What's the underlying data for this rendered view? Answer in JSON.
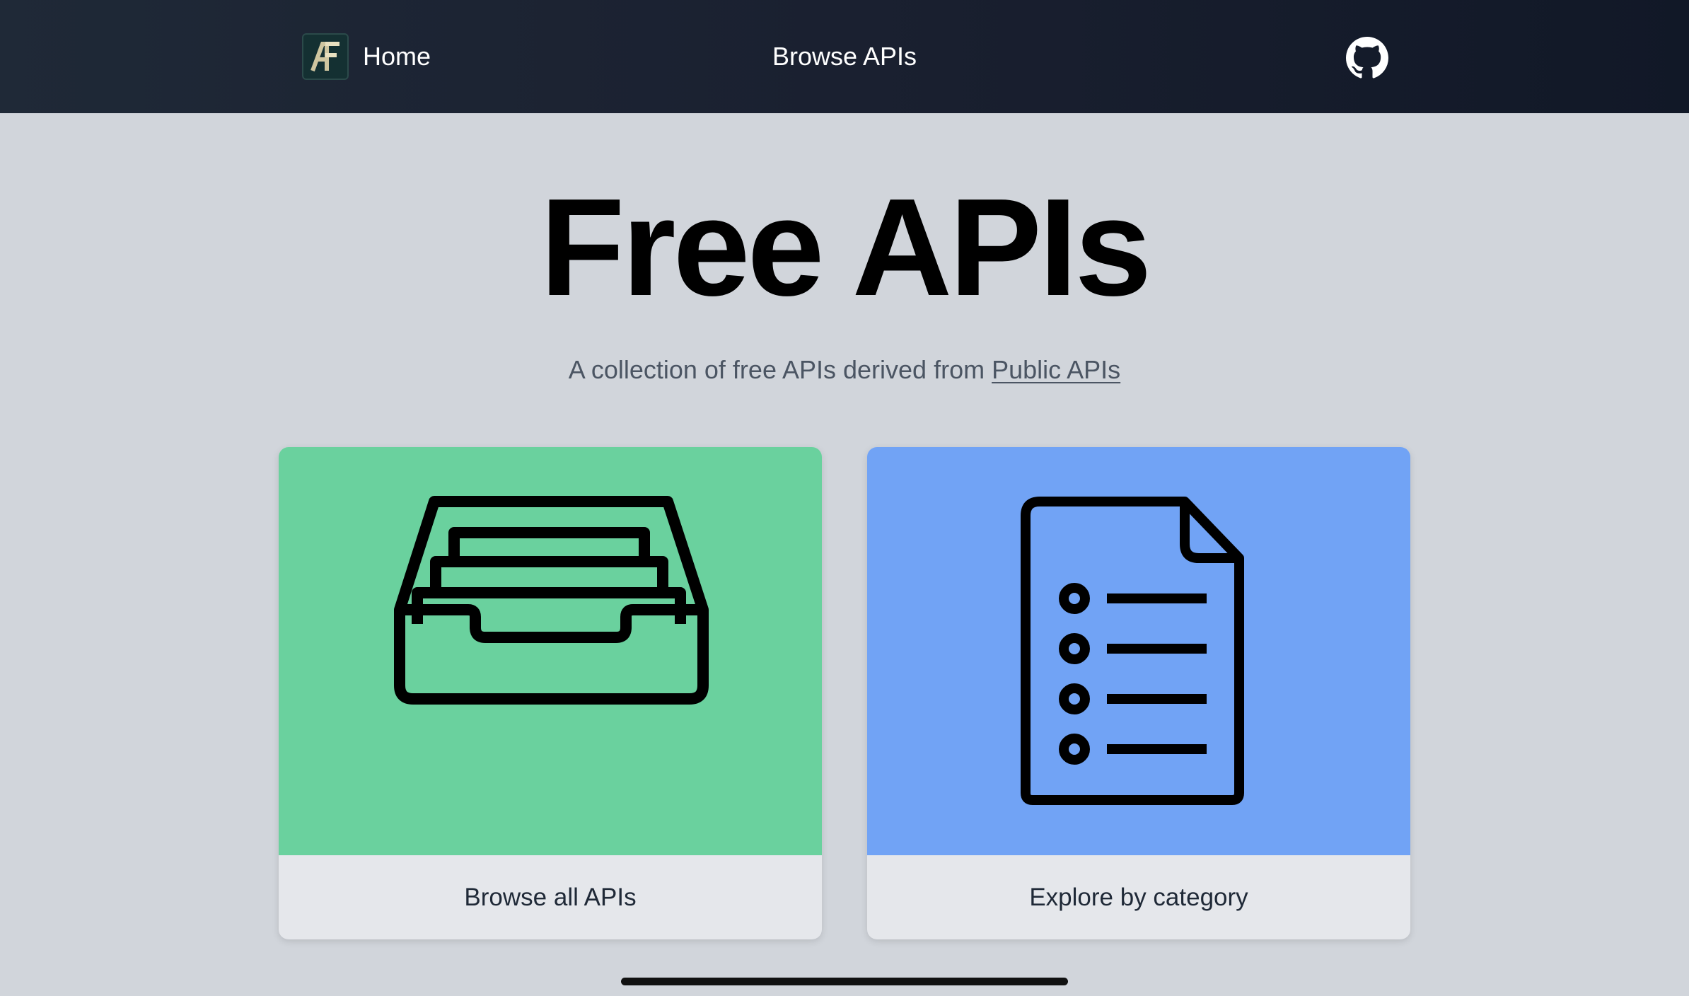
{
  "nav": {
    "logo_text": "AF",
    "home_label": "Home",
    "browse_label": "Browse APIs",
    "github_icon": "github-icon"
  },
  "hero": {
    "title": "Free APIs",
    "subtitle_prefix": "A collection of free APIs derived from ",
    "subtitle_link": "Public APIs"
  },
  "cards": [
    {
      "label": "Browse all APIs",
      "icon": "archive-tray-icon",
      "color": "#6ad19e"
    },
    {
      "label": "Explore by category",
      "icon": "document-list-icon",
      "color": "#71a3f5"
    }
  ],
  "colors": {
    "navbar": "#1f2937",
    "background": "#d1d5db",
    "card_footer": "#e5e7eb"
  }
}
